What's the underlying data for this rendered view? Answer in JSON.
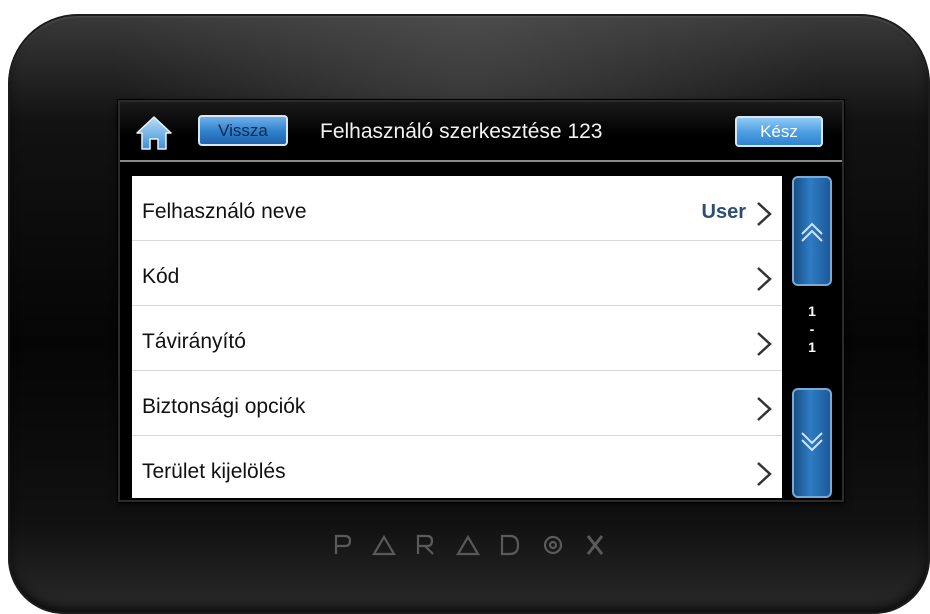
{
  "header": {
    "home_icon": "home-icon",
    "back_label": "Vissza",
    "title": "Felhasználó szerkesztése 123",
    "done_label": "Kész"
  },
  "list": {
    "items": [
      {
        "label": "Felhasználó neve",
        "value": "User"
      },
      {
        "label": "Kód",
        "value": ""
      },
      {
        "label": "Távirányító",
        "value": ""
      },
      {
        "label": "Biztonsági opciók",
        "value": ""
      },
      {
        "label": "Terület kijelölés",
        "value": ""
      }
    ]
  },
  "pager": {
    "current": "1",
    "separator": "-",
    "total": "1"
  },
  "brand": {
    "logo_text": "PARADOX"
  },
  "colors": {
    "button_blue": "#2f7fcc",
    "value_text": "#2b4f73",
    "screen_bg": "#000000"
  }
}
